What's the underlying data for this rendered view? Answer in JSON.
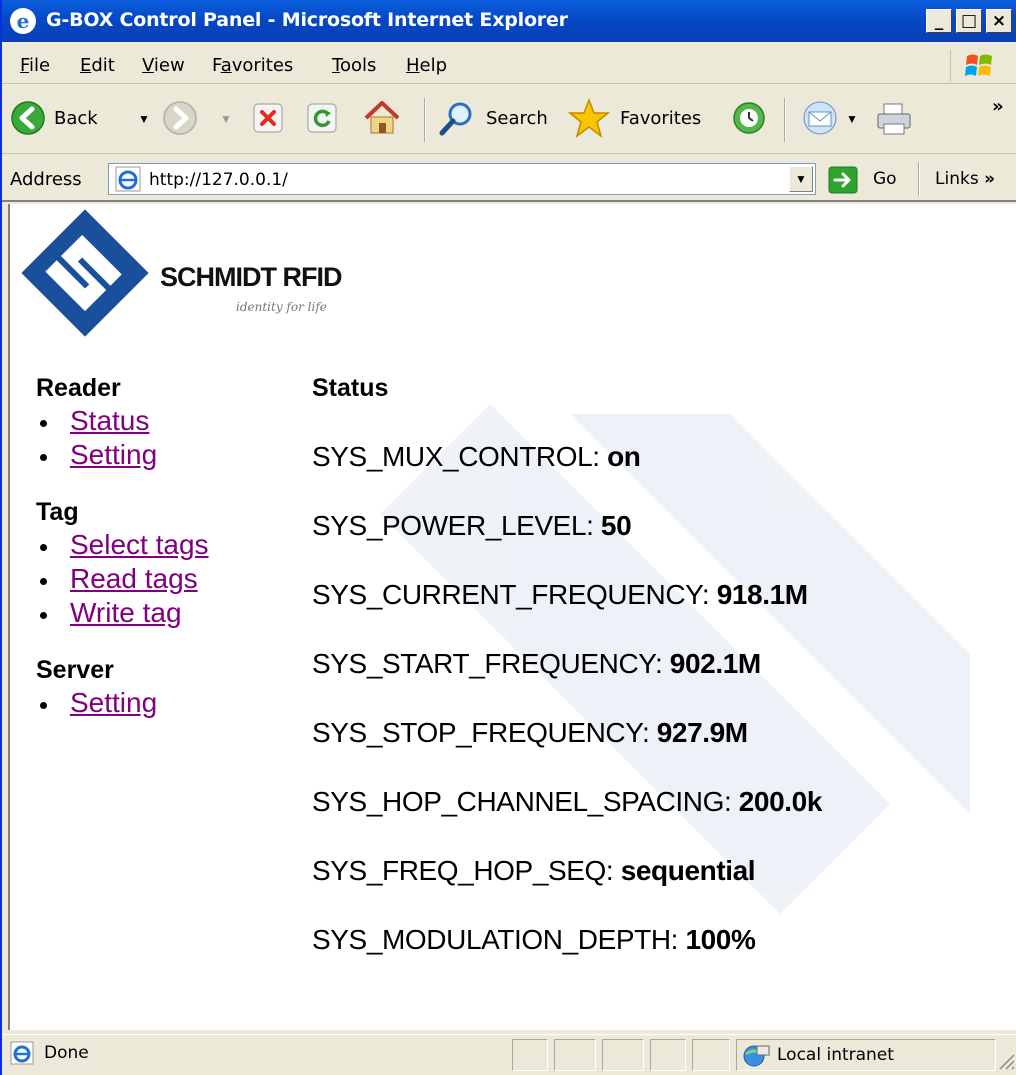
{
  "window": {
    "title": "G-BOX Control Panel - Microsoft Internet Explorer",
    "buttons": [
      "_",
      "□",
      "×"
    ]
  },
  "menu": [
    {
      "label": "File",
      "accel": "F"
    },
    {
      "label": "Edit",
      "accel": "E"
    },
    {
      "label": "View",
      "accel": "V"
    },
    {
      "label": "Favorites",
      "accel": "a"
    },
    {
      "label": "Tools",
      "accel": "T"
    },
    {
      "label": "Help",
      "accel": "H"
    }
  ],
  "toolbar": {
    "back_label": "Back",
    "search_label": "Search",
    "favorites_label": "Favorites",
    "chevron": "»"
  },
  "address": {
    "label": "Address",
    "url": "http://127.0.0.1/",
    "go_label": "Go",
    "links_label": "Links",
    "links_chevron": "»"
  },
  "logo": {
    "brand": "SCHMIDT RFID",
    "tagline": "identity for life"
  },
  "nav": {
    "sections": [
      {
        "heading": "Reader",
        "links": [
          "Status",
          "Setting"
        ]
      },
      {
        "heading": "Tag",
        "links": [
          "Select tags",
          "Read tags",
          "Write tag"
        ]
      },
      {
        "heading": "Server",
        "links": [
          "Setting"
        ]
      }
    ]
  },
  "main": {
    "heading": "Status",
    "rows": [
      {
        "key": "SYS_MUX_CONTROL:",
        "value": "on"
      },
      {
        "key": "SYS_POWER_LEVEL:",
        "value": "50"
      },
      {
        "key": "SYS_CURRENT_FREQUENCY:",
        "value": "918.1M"
      },
      {
        "key": "SYS_START_FREQUENCY:",
        "value": "902.1M"
      },
      {
        "key": "SYS_STOP_FREQUENCY:",
        "value": "927.9M"
      },
      {
        "key": "SYS_HOP_CHANNEL_SPACING:",
        "value": "200.0k"
      },
      {
        "key": "SYS_FREQ_HOP_SEQ:",
        "value": "sequential"
      },
      {
        "key": "SYS_MODULATION_DEPTH:",
        "value": "100%"
      }
    ]
  },
  "statusbar": {
    "status_text": "Done",
    "zone_text": "Local intranet"
  },
  "colors": {
    "titlebar": "#0548c6",
    "chrome": "#ece9d8",
    "visited_link": "#800080",
    "logo_blue": "#1a4f9c"
  }
}
